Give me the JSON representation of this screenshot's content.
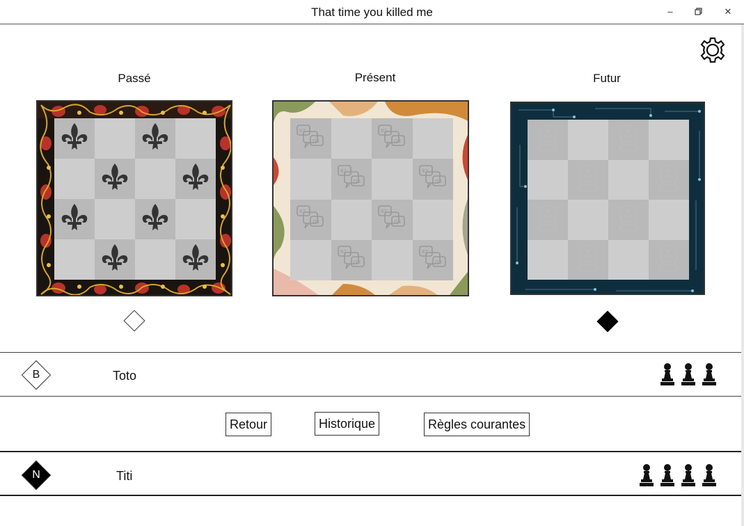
{
  "window": {
    "title": "That time you killed me"
  },
  "boards": [
    {
      "label": "Passé",
      "theme": "baroque-red-gold",
      "piece_icon": "fleur-de-lis-icon",
      "indicator": "empty"
    },
    {
      "label": "Présent",
      "theme": "pastel-abstract",
      "piece_icon": "chat-bubbles-icon",
      "indicator": "none"
    },
    {
      "label": "Futur",
      "theme": "circuit-teal",
      "piece_icon": "robot-head-icon",
      "indicator": "filled"
    }
  ],
  "players": [
    {
      "badge": "B",
      "name": "Toto",
      "pawns": 3,
      "badge_style": "white"
    },
    {
      "badge": "N",
      "name": "Titi",
      "pawns": 4,
      "badge_style": "black"
    }
  ],
  "actions": {
    "back": "Retour",
    "history": "Historique",
    "rules": "Règles courantes"
  },
  "colors": {
    "cell_dark": "#b9b9b9",
    "cell_light": "#cdcdcd",
    "piece": "#333333"
  }
}
